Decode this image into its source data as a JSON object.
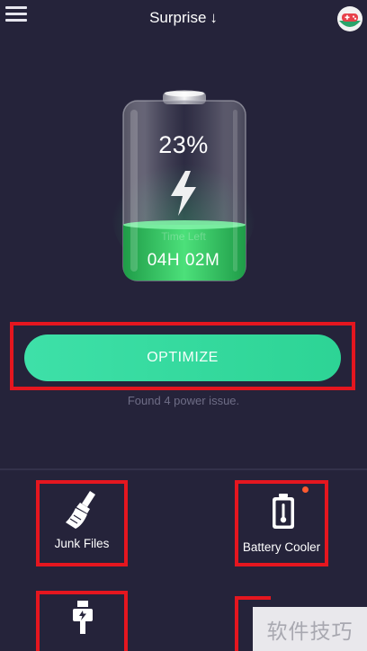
{
  "header": {
    "title": "Surprise",
    "title_arrow": "↓"
  },
  "battery": {
    "percent_text": "23%",
    "charge_level": 0.23,
    "time_left_label": "Time Left",
    "time_left_value": "04H 02M"
  },
  "optimize": {
    "button_label": "OPTIMIZE",
    "status_text": "Found 4 power issue."
  },
  "tiles": [
    {
      "label": "Junk Files",
      "icon": "broom-icon"
    },
    {
      "label": "Battery Cooler",
      "icon": "thermometer-battery-icon",
      "has_notification": true
    },
    {
      "label": "",
      "icon": "plug-icon"
    },
    {
      "label": "",
      "icon": ""
    }
  ],
  "watermark": {
    "text": "软件技巧"
  },
  "colors": {
    "background": "#25233a",
    "accent_green": "#2dd495",
    "highlight_red": "#e5161f",
    "notification": "#ff5a30"
  }
}
